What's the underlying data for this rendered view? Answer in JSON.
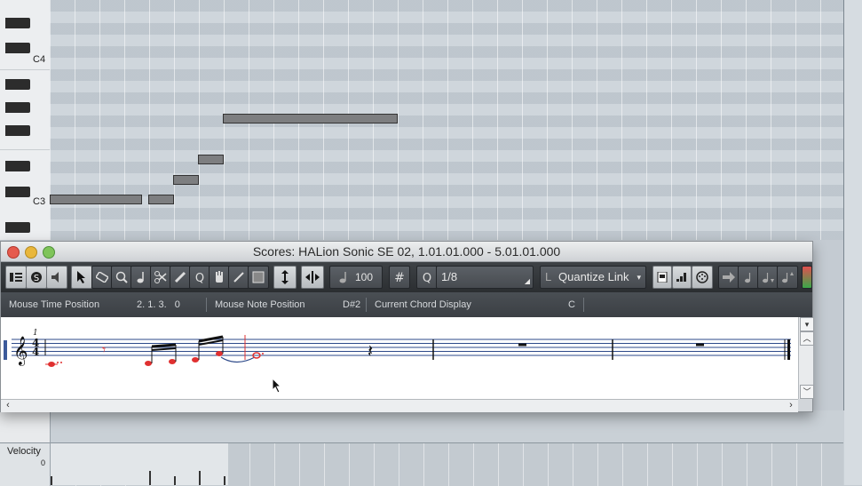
{
  "piano_roll": {
    "key_labels": {
      "c4": "C4",
      "c3": "C3"
    },
    "velocity_label": "Velocity",
    "velocity_zero": "0"
  },
  "score_window": {
    "title": "Scores: HALion Sonic SE 02, 1.01.01.000 - 5.01.01.000",
    "toolbar": {
      "velocity_value": "100",
      "quantize_value": "1/8",
      "quantize_link": "Quantize Link"
    },
    "info_line": {
      "mouse_time_label": "Mouse Time Position",
      "mouse_time_value": "2. 1. 3.   0",
      "mouse_note_label": "Mouse Note Position",
      "mouse_note_value": "D#2",
      "chord_label": "Current Chord Display",
      "chord_value": "C"
    },
    "score": {
      "time_signature_top": "4",
      "time_signature_bottom": "4",
      "measure_number": "1",
      "note_color": "#e03030"
    }
  },
  "colors": {
    "note_block": "#7d7e80",
    "toolbar_bg": "#2b2e31",
    "info_bg": "#3b3f44"
  }
}
